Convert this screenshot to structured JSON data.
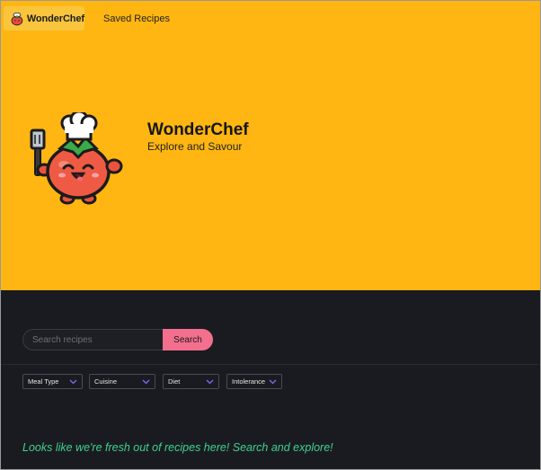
{
  "nav": {
    "brand_label": "WonderChef",
    "saved_label": "Saved Recipes"
  },
  "hero": {
    "title": "WonderChef",
    "tagline": "Explore and Savour"
  },
  "search": {
    "placeholder": "Search recipes",
    "value": "",
    "button_label": "Search"
  },
  "filters": [
    {
      "label": "Meal Type"
    },
    {
      "label": "Cuisine"
    },
    {
      "label": "Diet"
    },
    {
      "label": "Intolerance"
    }
  ],
  "empty_message": "Looks like we're fresh out of recipes here! Search and explore!",
  "colors": {
    "hero_bg": "#FFB612",
    "dark_bg": "#1A1B20",
    "accent_pink": "#F36F8E",
    "message_green": "#3ED28E"
  }
}
